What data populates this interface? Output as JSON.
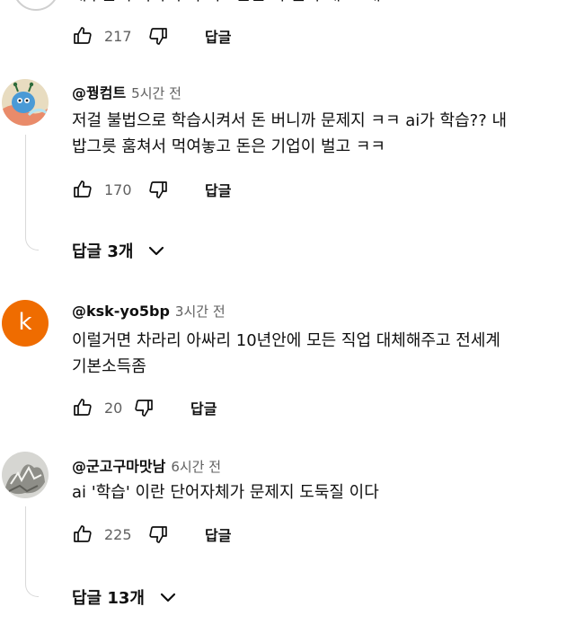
{
  "top_partial": {
    "text": "대부분 구독자 구독 다르는는 다 돌아 해 그 대",
    "likes": "217",
    "reply_label": "답글"
  },
  "comments": [
    {
      "author": "@꿩컴트",
      "time": "5시간 전",
      "lines": [
        "저걸 불법으로 학습시켜서 돈 버니까 문제지 ㅋㅋ ai가 학습?? 내",
        "밥그릇 훔쳐서 먹여놓고 돈은 기업이 벌고 ㅋㅋ"
      ],
      "likes": "170",
      "reply_label": "답글",
      "replies_label": "답글 3개"
    },
    {
      "author": "@ksk-yo5bp",
      "time": "3시간 전",
      "avatar_letter": "k",
      "lines": [
        "이럴거면 차라리 아싸리 10년안에 모든 직업 대체해주고 전세계",
        "기본소득좀"
      ],
      "likes": "20",
      "reply_label": "답글"
    },
    {
      "author": "@군고구마맛남",
      "time": "6시간 전",
      "lines": [
        "ai '학습' 이란 단어자체가 문제지  도둑질 이다"
      ],
      "likes": "225",
      "reply_label": "답글",
      "replies_label": "답글 13개"
    }
  ],
  "colors": {
    "avatar_k": "#ef6c00",
    "meta_gray": "#606060",
    "thread_line": "#d9d9d9"
  }
}
